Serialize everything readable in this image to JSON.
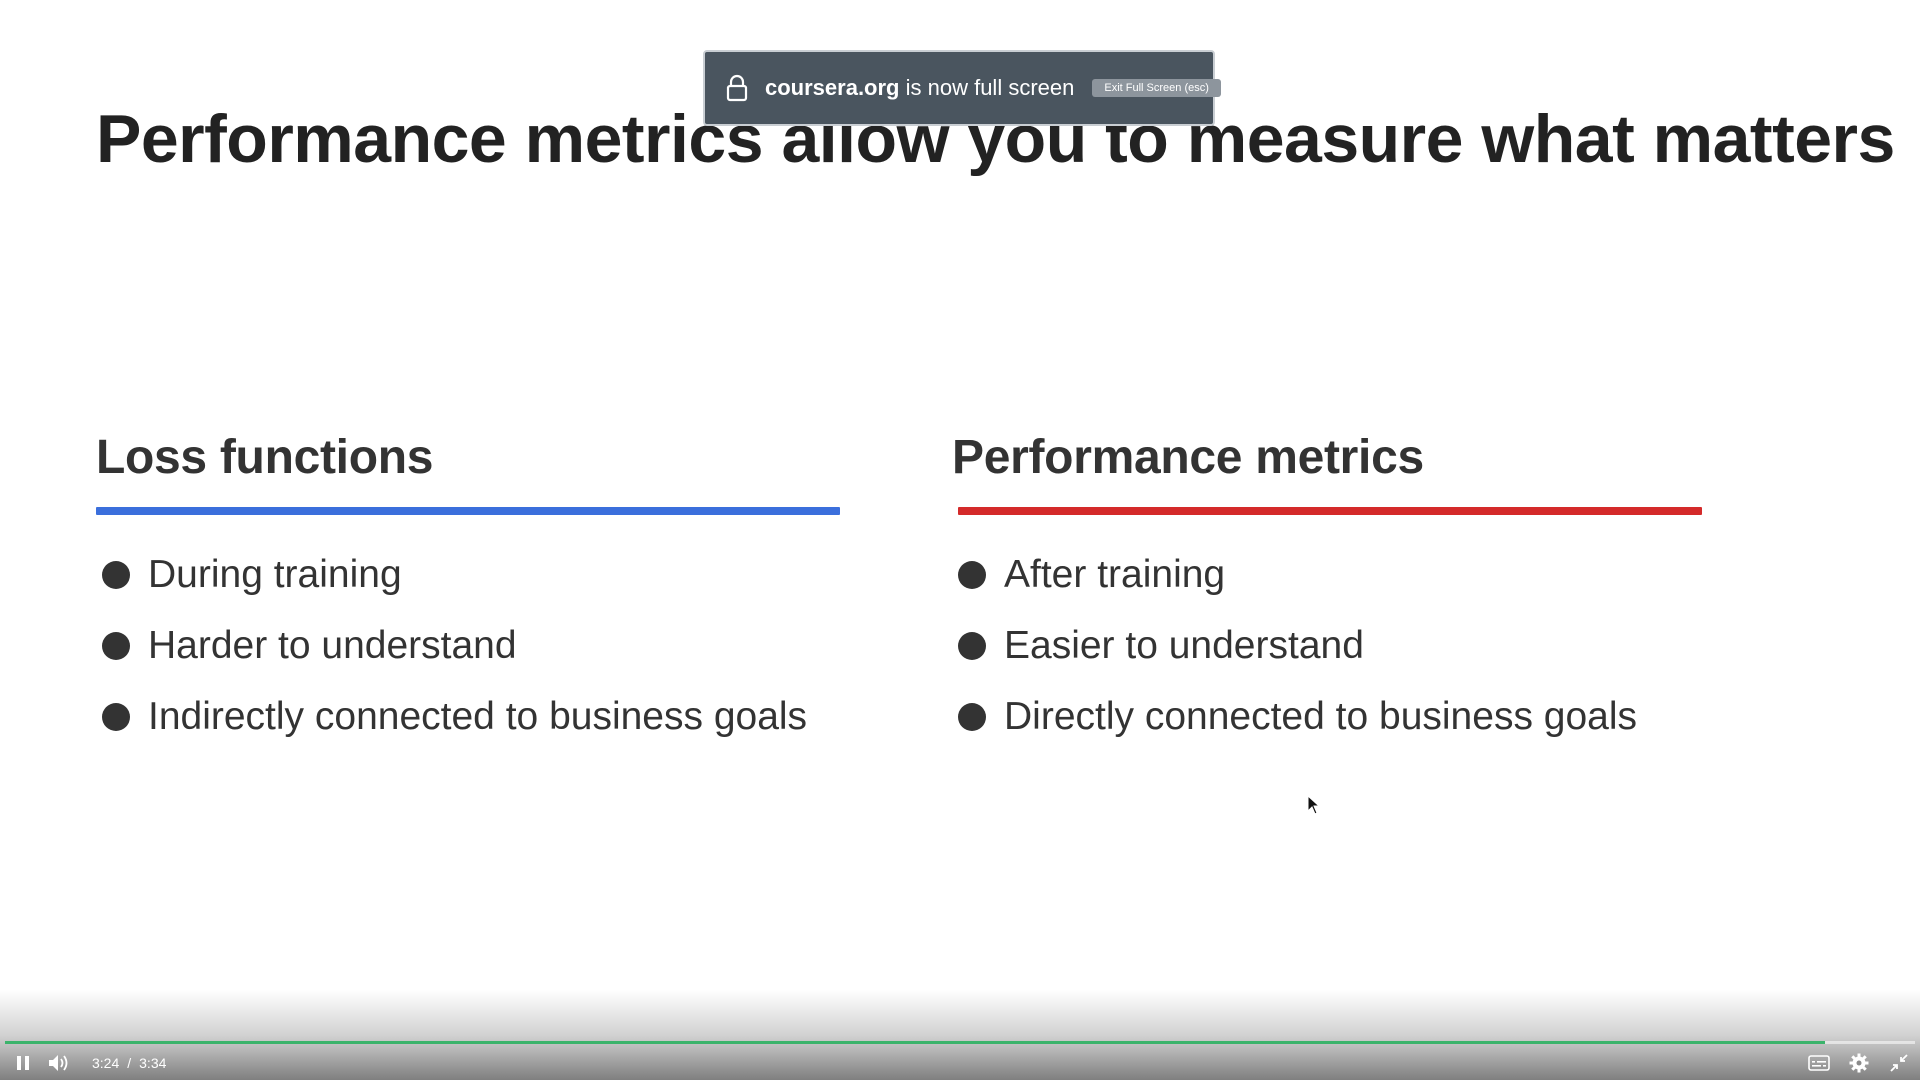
{
  "slide": {
    "title": "Performance metrics allow you to measure what matters",
    "left_column": {
      "heading": "Loss functions",
      "rule_color": "#3b6fdc",
      "bullets": [
        "During training",
        "Harder to understand",
        "Indirectly connected to business goals"
      ]
    },
    "right_column": {
      "heading": "Performance metrics",
      "rule_color": "#d42a2a",
      "bullets": [
        "After training",
        "Easier to understand",
        "Directly connected to business goals"
      ]
    }
  },
  "fullscreen_notice": {
    "domain": "coursera.org",
    "message": " is now full screen",
    "exit_label": "Exit Full Screen (esc)",
    "icon": "lock-icon"
  },
  "player": {
    "current_time": "3:24",
    "separator": "/",
    "duration": "3:34",
    "progress_fraction": 0.953,
    "progress_color": "#3bb36b",
    "icons": [
      "pause-icon",
      "volume-icon",
      "captions-icon",
      "settings-icon",
      "exit-fullscreen-icon"
    ]
  }
}
